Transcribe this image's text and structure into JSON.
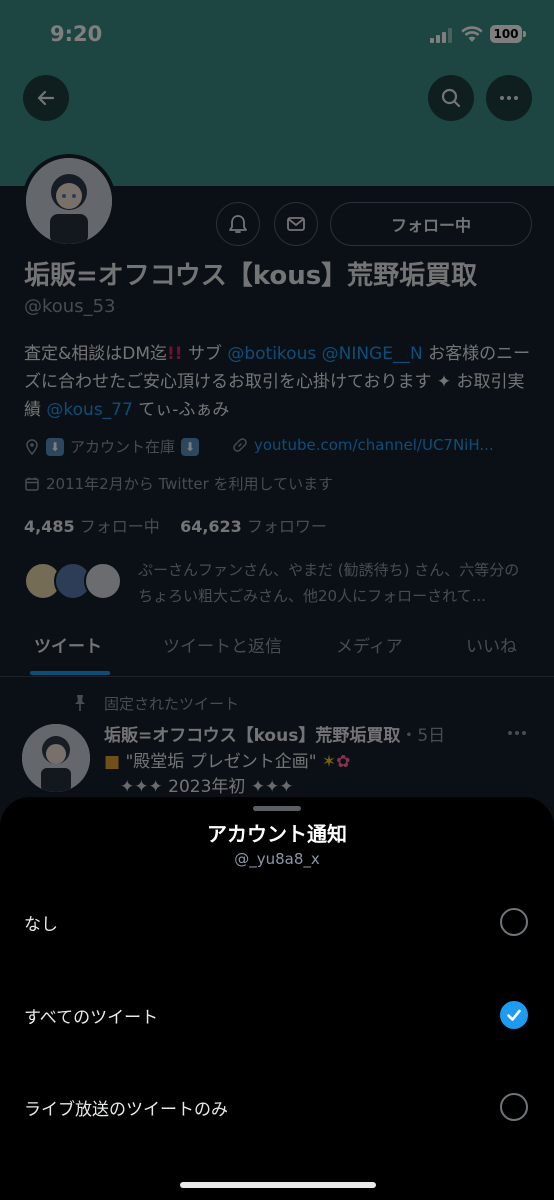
{
  "status_bar": {
    "time": "9:20",
    "battery": "100"
  },
  "profile": {
    "follow_button_label": "フォロー中",
    "display_name": "垢販=オフコウス【kous】荒野垢買取",
    "handle": "@kous_53",
    "bio": {
      "part1": "査定&相談はDM迄",
      "part2": "サブ ",
      "mention1": "@botikous",
      "mention2": "@NINGE__N",
      "part3": " お客様のニーズに合わせたご安心頂けるお取引を心掛けております",
      "part4": " お取引実績 ",
      "mention3": "@kous_77",
      "part5": " てぃ-ふぁみ"
    },
    "location": "アカウント在庫",
    "website": "youtube.com/channel/UC7NiH...",
    "joined": "2011年2月から Twitter を利用しています",
    "following_count": "4,485",
    "following_label": "フォロー中",
    "followers_count": "64,623",
    "followers_label": "フォロワー",
    "followed_by_text": "ぷーさんファンさん、やまだ (勧誘待ち) さん、六等分のちょろい粗大ごみさん、他20人にフォローされて..."
  },
  "tabs": [
    {
      "label": "ツイート",
      "active": true
    },
    {
      "label": "ツイートと返信",
      "active": false
    },
    {
      "label": "メディア",
      "active": false
    },
    {
      "label": "いいね",
      "active": false
    }
  ],
  "pinned_tweet": {
    "pinned_label": "固定されたツイート",
    "author": "垢販=オフコウス【kous】荒野垢買取",
    "time": "・5日",
    "line1": "\"殿堂垢 プレゼント企画\"",
    "line2": "2023年初"
  },
  "sheet": {
    "title": "アカウント通知",
    "subtitle": "@_yu8a8_x",
    "options": [
      {
        "label": "なし",
        "selected": false
      },
      {
        "label": "すべてのツイート",
        "selected": true
      },
      {
        "label": "ライブ放送のツイートのみ",
        "selected": false
      }
    ]
  },
  "colors": {
    "accent": "#1d9bf0",
    "background": "#15202b",
    "banner": "#3a8c84",
    "sheet": "#000000"
  }
}
